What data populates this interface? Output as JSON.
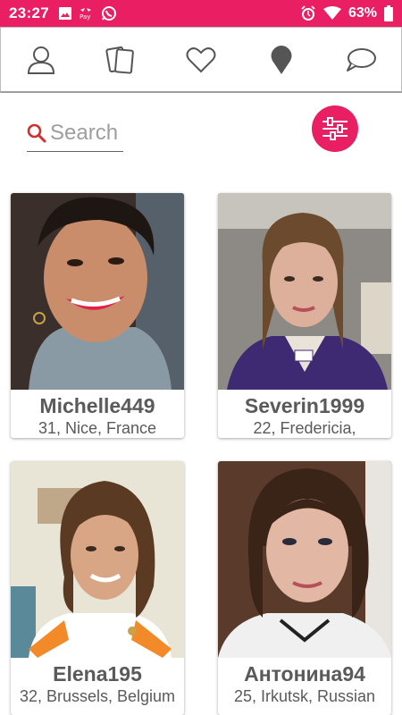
{
  "status_bar": {
    "time": "23:27",
    "battery": "63%",
    "icons": [
      "image-icon",
      "payapp-icon",
      "whatsapp-icon",
      "alarm-icon",
      "wifi-icon",
      "battery-icon"
    ]
  },
  "tabs": [
    {
      "name": "profile",
      "icon": "person-icon"
    },
    {
      "name": "cards",
      "icon": "cards-icon"
    },
    {
      "name": "likes",
      "icon": "heart-icon"
    },
    {
      "name": "nearby",
      "icon": "location-pin-icon"
    },
    {
      "name": "messages",
      "icon": "chat-bubble-icon"
    }
  ],
  "search": {
    "placeholder": "Search",
    "value": ""
  },
  "filter": {
    "icon": "sliders-icon"
  },
  "colors": {
    "accent": "#e91e63",
    "text": "#5a5a5a",
    "search_icon": "#d32f2f"
  },
  "profiles": [
    {
      "username": "Michelle449",
      "info": "31, Nice, France"
    },
    {
      "username": "Severin1999",
      "info": "22, Fredericia,"
    },
    {
      "username": "Elena195",
      "info": "32, Brussels, Belgium"
    },
    {
      "username": "Антонина94",
      "info": "25, Irkutsk, Russian"
    }
  ]
}
